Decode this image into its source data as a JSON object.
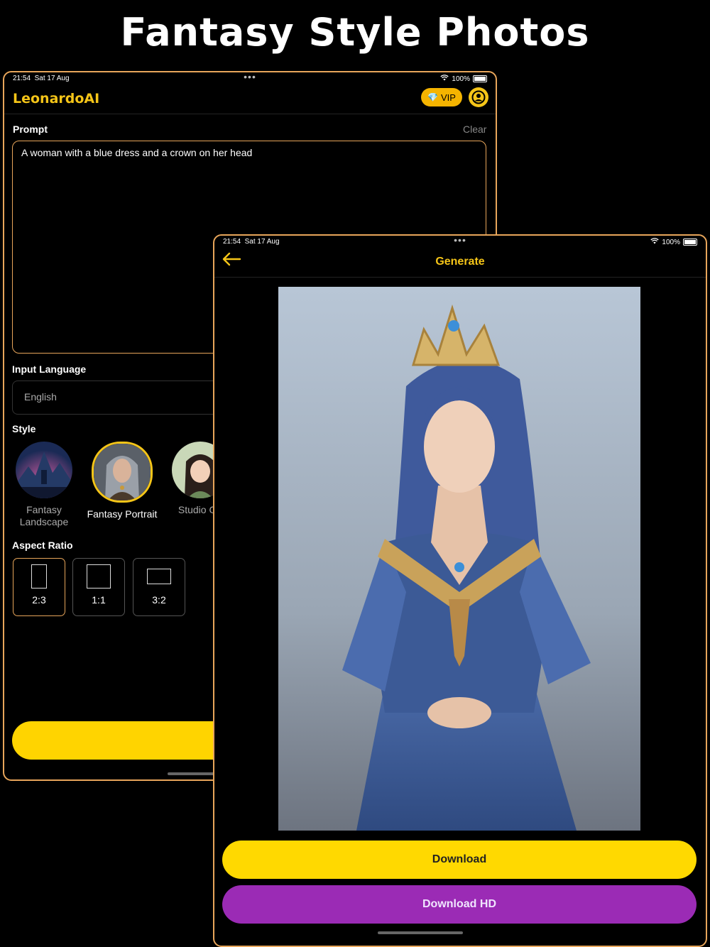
{
  "headline": "Fantasy Style Photos",
  "status": {
    "time": "21:54",
    "date": "Sat 17 Aug",
    "battery": "100%"
  },
  "editor": {
    "brand": "LeonardoAI",
    "vip_label": "VIP",
    "prompt_label": "Prompt",
    "clear_label": "Clear",
    "prompt_value": "A woman with a blue dress and a crown on her head",
    "language_label": "Input Language",
    "language_value": "English",
    "style_label": "Style",
    "styles": [
      {
        "name": "Fantasy Landscape",
        "selected": false
      },
      {
        "name": "Fantasy Portrait",
        "selected": true
      },
      {
        "name": "Studio Gh",
        "selected": false
      }
    ],
    "aspect_label": "Aspect Ratio",
    "ratios": [
      {
        "label": "2:3",
        "selected": true
      },
      {
        "label": "1:1",
        "selected": false
      },
      {
        "label": "3:2",
        "selected": false
      }
    ]
  },
  "result": {
    "title": "Generate",
    "download_label": "Download",
    "download_hd_label": "Download HD"
  },
  "colors": {
    "accent": "#f5c518",
    "border": "#e7a55a",
    "download": "#ffd900",
    "download_hd": "#9b2bb5"
  }
}
